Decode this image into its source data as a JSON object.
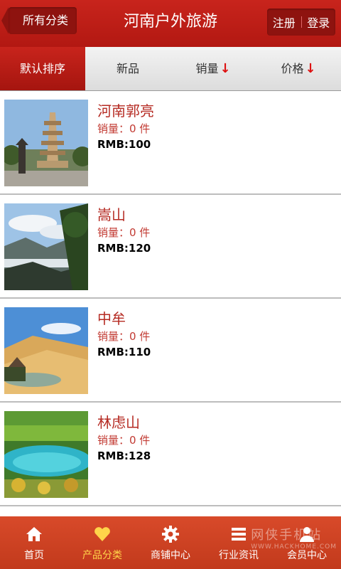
{
  "header": {
    "back_label": "所有分类",
    "title": "河南户外旅游",
    "register_label": "注册",
    "login_label": "登录"
  },
  "sort_tabs": [
    {
      "label": "默认排序",
      "active": true
    },
    {
      "label": "新品",
      "active": false
    },
    {
      "label": "销量",
      "arrow": "↓"
    },
    {
      "label": "价格",
      "arrow": "↓"
    }
  ],
  "products": [
    {
      "title": "河南郭亮",
      "sales": "销量：0 件",
      "price": "RMB:100",
      "image": "pagoda-photo"
    },
    {
      "title": "嵩山",
      "sales": "销量：0 件",
      "price": "RMB:120",
      "image": "mountain-photo"
    },
    {
      "title": "中牟",
      "sales": "销量：0 件",
      "price": "RMB:110",
      "image": "desert-photo"
    },
    {
      "title": "林虑山",
      "sales": "销量：0 件",
      "price": "RMB:128",
      "image": "lake-forest-photo"
    }
  ],
  "bottom_nav": [
    {
      "label": "首页",
      "icon": "home-icon"
    },
    {
      "label": "产品分类",
      "icon": "heart-icon",
      "active": true
    },
    {
      "label": "商铺中心",
      "icon": "gear-icon"
    },
    {
      "label": "行业资讯",
      "icon": "list-icon"
    },
    {
      "label": "会员中心",
      "icon": "user-icon"
    }
  ],
  "watermark": {
    "text": "网侠手机站",
    "sub": "WWW.HACKHOME.COM"
  },
  "colors": {
    "brand_red": "#b21812",
    "accent_yellow": "#ffd44a",
    "title_red": "#b52a22"
  }
}
